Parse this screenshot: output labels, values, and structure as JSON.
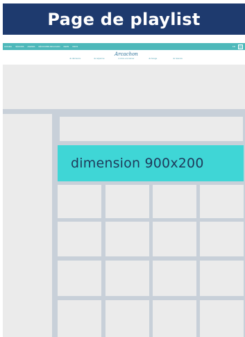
{
  "page": {
    "title": "Page de playlist"
  },
  "mockup": {
    "topbar": {
      "items": [
        "ACCUEIL",
        "SÉJOURS",
        "AGENDA",
        "DÉCOUVRIR ARCACHON",
        "NEWS",
        "INFOS"
      ],
      "lang": "FR",
      "color": "#4db8ba"
    },
    "nav": {
      "left_links": [
        "Je découvre",
        "Je séjourne"
      ],
      "right_links": [
        "Je bouge",
        "Je réserve"
      ],
      "logo": "Arcachon",
      "tagline": "à vivre et à aimer"
    },
    "banner": {
      "label": "dimension 900x200",
      "color": "#3fd6d6"
    },
    "grid": {
      "columns": 4,
      "rows": 4
    }
  }
}
